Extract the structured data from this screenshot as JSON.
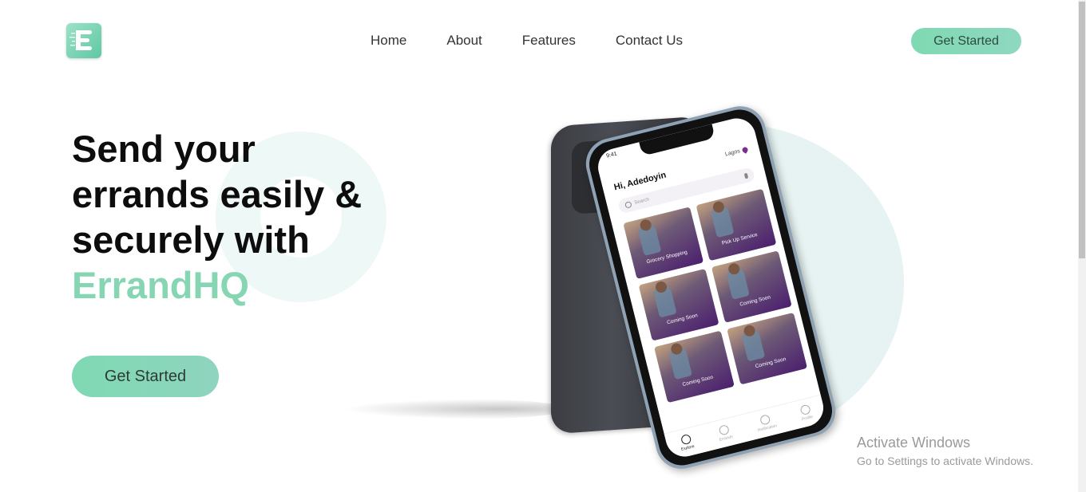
{
  "header": {
    "logo_icon": "errandhq-logo-icon",
    "nav": [
      "Home",
      "About",
      "Features",
      "Contact Us"
    ],
    "cta_label": "Get Started"
  },
  "hero": {
    "headline_lines": [
      "Send your",
      "errands easily &",
      "securely with"
    ],
    "brand": "ErrandHQ",
    "cta_label": "Get Started"
  },
  "phone_screen": {
    "time": "9:41",
    "greeting": "Hi, Adedoyin",
    "location": "Lagos",
    "search_placeholder": "Search",
    "tiles": [
      "Grocery Shopping",
      "Pick Up Service",
      "Coming Soon",
      "Coming Soon",
      "Coming Soon",
      "Coming Soon"
    ],
    "tabs": [
      "Explore",
      "Errands",
      "Notification",
      "Profile"
    ]
  },
  "watermark": {
    "title": "Activate Windows",
    "subtitle": "Go to Settings to activate Windows."
  },
  "colors": {
    "accent": "#86d5b3",
    "button": "#7fd9b2",
    "purple": "#4b1f6e"
  }
}
